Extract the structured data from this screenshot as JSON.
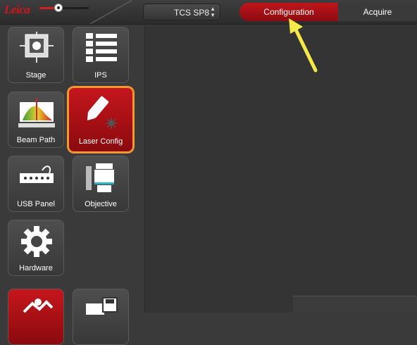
{
  "header": {
    "logo_text": "Leica",
    "system": "TCS SP8",
    "system_arrows": "▲▼",
    "workflow": {
      "configuration_label": "Configuration",
      "acquire_label": "Acquire"
    },
    "zoom_level": 0.38
  },
  "sidebar": {
    "tiles": [
      {
        "label": "Stage",
        "icon": "stage-icon"
      },
      {
        "label": "IPS",
        "icon": "ips-list-icon"
      },
      {
        "label": "Beam Path",
        "icon": "beam-path-icon"
      },
      {
        "label": "Laser Config",
        "icon": "laser-config-icon",
        "active": true
      },
      {
        "label": "USB Panel",
        "icon": "usb-panel-icon"
      },
      {
        "label": "Objective",
        "icon": "objective-icon"
      },
      {
        "label": "Hardware",
        "icon": "gear-icon"
      }
    ]
  },
  "colors": {
    "accent": "#c0161b",
    "highlight": "#f29a30",
    "annotation_arrow": "#f5e94a"
  }
}
